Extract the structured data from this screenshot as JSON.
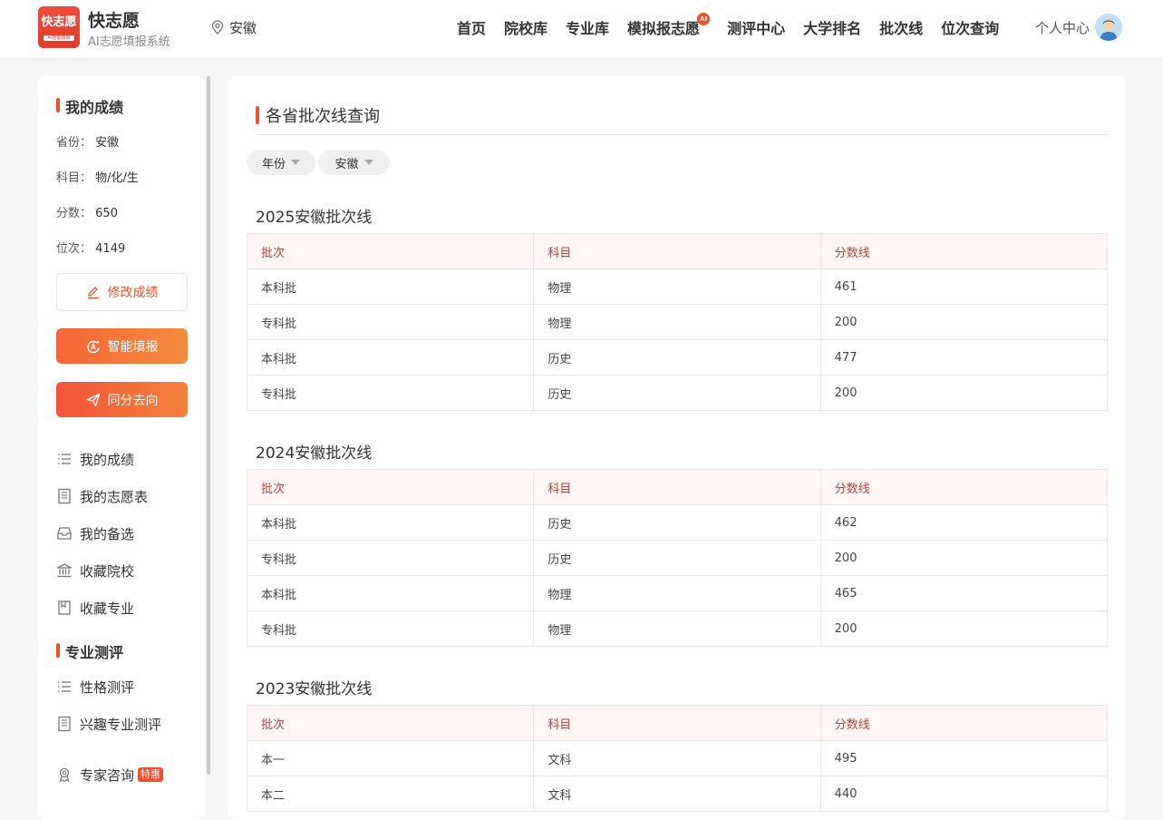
{
  "header": {
    "logo_text": "快志愿",
    "logo_tagline": "AI智能填报",
    "brand_name": "快志愿",
    "brand_sub": "AI志愿填报系统",
    "location": "安徽",
    "nav": [
      {
        "label": "首页"
      },
      {
        "label": "院校库"
      },
      {
        "label": "专业库"
      },
      {
        "label": "模拟报志愿",
        "badge": "AI"
      },
      {
        "label": "测评中心"
      },
      {
        "label": "大学排名"
      },
      {
        "label": "批次线"
      },
      {
        "label": "位次查询"
      }
    ],
    "user_center": "个人中心"
  },
  "sidebar": {
    "score_title": "我的成绩",
    "fields": [
      {
        "key": "省份：",
        "value": "安徽"
      },
      {
        "key": "科目：",
        "value": "物/化/生"
      },
      {
        "key": "分数：",
        "value": "650"
      },
      {
        "key": "位次：",
        "value": "4149"
      }
    ],
    "edit_button": "修改成绩",
    "smart_button": "智能填报",
    "same_score_button": "同分去向",
    "menu": [
      {
        "label": "我的成绩",
        "icon": "list-icon"
      },
      {
        "label": "我的志愿表",
        "icon": "document-icon"
      },
      {
        "label": "我的备选",
        "icon": "inbox-icon"
      },
      {
        "label": "收藏院校",
        "icon": "school-icon"
      },
      {
        "label": "收藏专业",
        "icon": "bookmark-icon"
      }
    ],
    "test_title": "专业测评",
    "test_menu": [
      {
        "label": "性格测评",
        "icon": "list-icon"
      },
      {
        "label": "兴趣专业测评",
        "icon": "document-icon"
      }
    ],
    "expert": {
      "label": "专家咨询",
      "badge": "特惠",
      "icon": "award-icon"
    }
  },
  "main": {
    "title": "各省批次线查询",
    "filters": [
      {
        "label": "年份"
      },
      {
        "label": "安徽"
      }
    ],
    "columns": [
      "批次",
      "科目",
      "分数线"
    ],
    "sections": [
      {
        "title": "2025安徽批次线",
        "rows": [
          [
            "本科批",
            "物理",
            "461"
          ],
          [
            "专科批",
            "物理",
            "200"
          ],
          [
            "本科批",
            "历史",
            "477"
          ],
          [
            "专科批",
            "历史",
            "200"
          ]
        ]
      },
      {
        "title": "2024安徽批次线",
        "rows": [
          [
            "本科批",
            "历史",
            "462"
          ],
          [
            "专科批",
            "历史",
            "200"
          ],
          [
            "本科批",
            "物理",
            "465"
          ],
          [
            "专科批",
            "物理",
            "200"
          ]
        ]
      },
      {
        "title": "2023安徽批次线",
        "rows": [
          [
            "本一",
            "文科",
            "495"
          ],
          [
            "本二",
            "文科",
            "440"
          ]
        ]
      }
    ]
  },
  "colors": {
    "accent": "#f0502f",
    "button_gradient_start": "#f7663a",
    "button_gradient_end": "#f58a3c",
    "table_header_bg": "#fff6f5",
    "table_header_text": "#b5453a"
  }
}
